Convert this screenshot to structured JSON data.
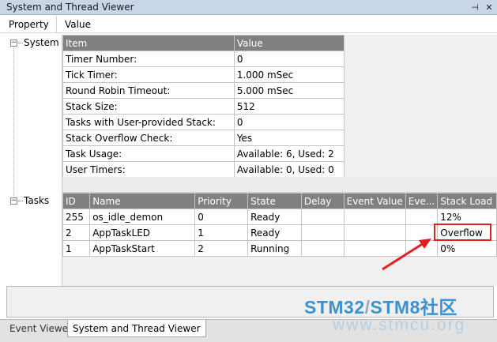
{
  "window": {
    "title": "System and Thread Viewer",
    "pin_glyph": "⊣",
    "close_glyph": "✕"
  },
  "header": {
    "property_label": "Property",
    "value_label": "Value"
  },
  "tree": {
    "system_label": "System",
    "tasks_label": "Tasks",
    "collapse_glyph": "−"
  },
  "system_table": {
    "columns": [
      "Item",
      "Value"
    ],
    "rows": [
      [
        "Timer Number:",
        "0"
      ],
      [
        "Tick Timer:",
        "1.000 mSec"
      ],
      [
        "Round Robin Timeout:",
        "5.000 mSec"
      ],
      [
        "Stack Size:",
        "512"
      ],
      [
        "Tasks with User-provided Stack:",
        "0"
      ],
      [
        "Stack Overflow Check:",
        "Yes"
      ],
      [
        "Task Usage:",
        "Available: 6, Used: 2"
      ],
      [
        "User Timers:",
        "Available: 0, Used: 0"
      ]
    ]
  },
  "tasks_table": {
    "columns": [
      "ID",
      "Name",
      "Priority",
      "State",
      "Delay",
      "Event Value",
      "Eve...",
      "Stack Load"
    ],
    "rows": [
      [
        "255",
        "os_idle_demon",
        "0",
        "Ready",
        "",
        "",
        "",
        "12%"
      ],
      [
        "2",
        "AppTaskLED",
        "1",
        "Ready",
        "",
        "",
        "",
        "Overflow"
      ],
      [
        "1",
        "AppTaskStart",
        "2",
        "Running",
        "",
        "",
        "",
        "0%"
      ]
    ]
  },
  "tabs": [
    {
      "label": "Event Viewer",
      "active": false
    },
    {
      "label": "System and Thread Viewer",
      "active": true
    }
  ],
  "watermark": {
    "part1": "STM32",
    "sep": "/",
    "part2": "STM8",
    "part3": "社区",
    "url": "www.stmcu.org"
  },
  "colors": {
    "callout": "#e0201e",
    "header_bg": "#808080",
    "watermark_blue": "#3b92cf"
  }
}
